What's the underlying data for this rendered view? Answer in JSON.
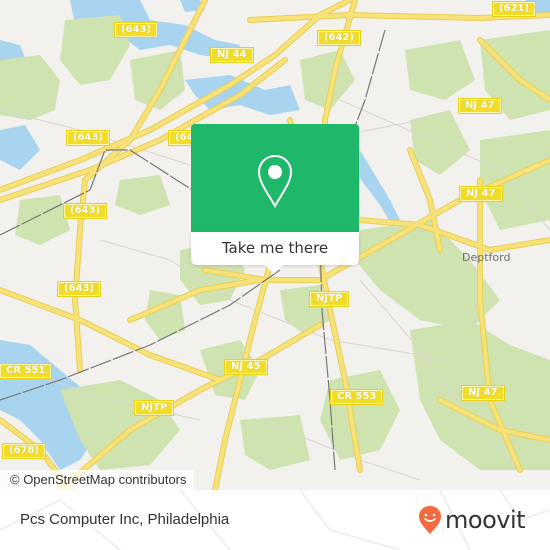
{
  "map": {
    "attribution": "© OpenStreetMap contributors",
    "colors": {
      "land": "#f2f1ee",
      "park": "#cfe3b0",
      "water": "#a9d4f0",
      "road_major": "#f7e27a",
      "road_outline": "#e8cf55",
      "rail": "#777777",
      "shield": "#f2dc2a",
      "popup_green": "#1fb86b"
    },
    "shields": [
      {
        "label": "(621)"
      },
      {
        "label": "(643)"
      },
      {
        "label": "(642)"
      },
      {
        "label": "NJ 44"
      },
      {
        "label": "(643)"
      },
      {
        "label": "(643)"
      },
      {
        "label": "NJ 47"
      },
      {
        "label": "NJ 47"
      },
      {
        "label": "(643)"
      },
      {
        "label": "NJTP"
      },
      {
        "label": "CR 551"
      },
      {
        "label": "NJ 45"
      },
      {
        "label": "CR 553"
      },
      {
        "label": "NJ 47"
      },
      {
        "label": "NJTP"
      },
      {
        "label": "(678)"
      },
      {
        "label": "(64"
      }
    ],
    "places": [
      {
        "label": "Deptford"
      }
    ]
  },
  "popup": {
    "icon": "map-pin-icon",
    "button_label": "Take me there"
  },
  "footer": {
    "place_name": "Pcs Computer Inc, Philadelphia",
    "brand": "moovit",
    "brand_color": "#f26a3d"
  }
}
